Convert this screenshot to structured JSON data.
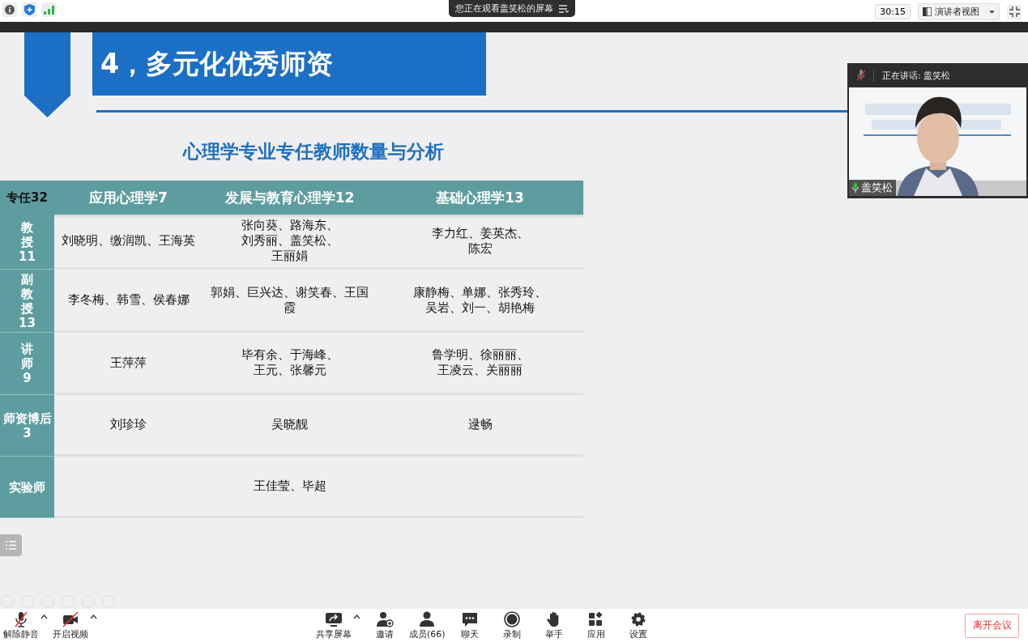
{
  "top_bar": {
    "banner": "您正在观看盖笑松的屏幕",
    "timer": "30:15",
    "view_mode": "演讲者视图"
  },
  "slide": {
    "title": "4，多元化优秀师资",
    "subtitle": "心理学专业专任教师数量与分析",
    "table": {
      "columns": [
        "专任32",
        "应用心理学7",
        "发展与教育心理学12",
        "基础心理学13"
      ],
      "rows": [
        {
          "cells": [
            {
              "kind": "row_header",
              "lines": [
                "教",
                "授",
                "11"
              ]
            },
            {
              "lines": [
                "刘晓明、缴润凯、王海英"
              ]
            },
            {
              "lines": [
                "张向葵、路海东、",
                "刘秀丽、盖笑松、",
                "王丽娟"
              ]
            },
            {
              "lines": [
                "李力红、姜英杰、",
                "陈宏"
              ]
            }
          ]
        },
        {
          "cells": [
            {
              "kind": "row_header",
              "lines": [
                "副",
                "教",
                "授",
                "13"
              ]
            },
            {
              "lines": [
                "李冬梅、韩雪、侯春娜"
              ]
            },
            {
              "lines": [
                "郭娟、巨兴达、谢笑春、王国",
                "霞"
              ]
            },
            {
              "lines": [
                "康静梅、单娜、张秀玲、",
                "吴岩、刘一、胡艳梅"
              ]
            }
          ]
        },
        {
          "cells": [
            {
              "kind": "row_header",
              "lines": [
                "讲",
                "师",
                "9"
              ]
            },
            {
              "lines": [
                "王萍萍"
              ]
            },
            {
              "lines": [
                "毕有余、于海峰、",
                "王元、张馨元"
              ]
            },
            {
              "lines": [
                "鲁学明、徐丽丽、",
                "王凌云、关丽丽"
              ]
            }
          ]
        },
        {
          "cells": [
            {
              "kind": "row_header",
              "lines": [
                "师资博后",
                "3"
              ]
            },
            {
              "lines": [
                "刘珍珍"
              ]
            },
            {
              "lines": [
                "吴晓靓"
              ]
            },
            {
              "lines": [
                "逯畅"
              ]
            }
          ]
        },
        {
          "cells": [
            {
              "kind": "row_header",
              "lines": [
                "实验师"
              ]
            },
            {
              "kind": "empty"
            },
            {
              "lines": [
                "王佳莹、毕超"
              ]
            },
            {
              "kind": "empty"
            }
          ]
        }
      ]
    }
  },
  "video": {
    "speaking": "正在讲话: 盖笑松",
    "name": "盖笑松",
    "muted": true
  },
  "toolbar": {
    "left": [
      {
        "kind": "mic",
        "label": "解除静音"
      },
      {
        "kind": "camera",
        "label": "开启视频"
      }
    ],
    "center": [
      {
        "kind": "share",
        "label": "共享屏幕"
      },
      {
        "kind": "invite",
        "label": "邀请"
      },
      {
        "kind": "members",
        "label": "成员(66)"
      },
      {
        "kind": "chat",
        "label": "聊天"
      },
      {
        "kind": "record",
        "label": "录制"
      },
      {
        "kind": "hand",
        "label": "举手"
      },
      {
        "kind": "apps",
        "label": "应用"
      },
      {
        "kind": "settings",
        "label": "设置"
      }
    ],
    "leave": "离开会议"
  }
}
